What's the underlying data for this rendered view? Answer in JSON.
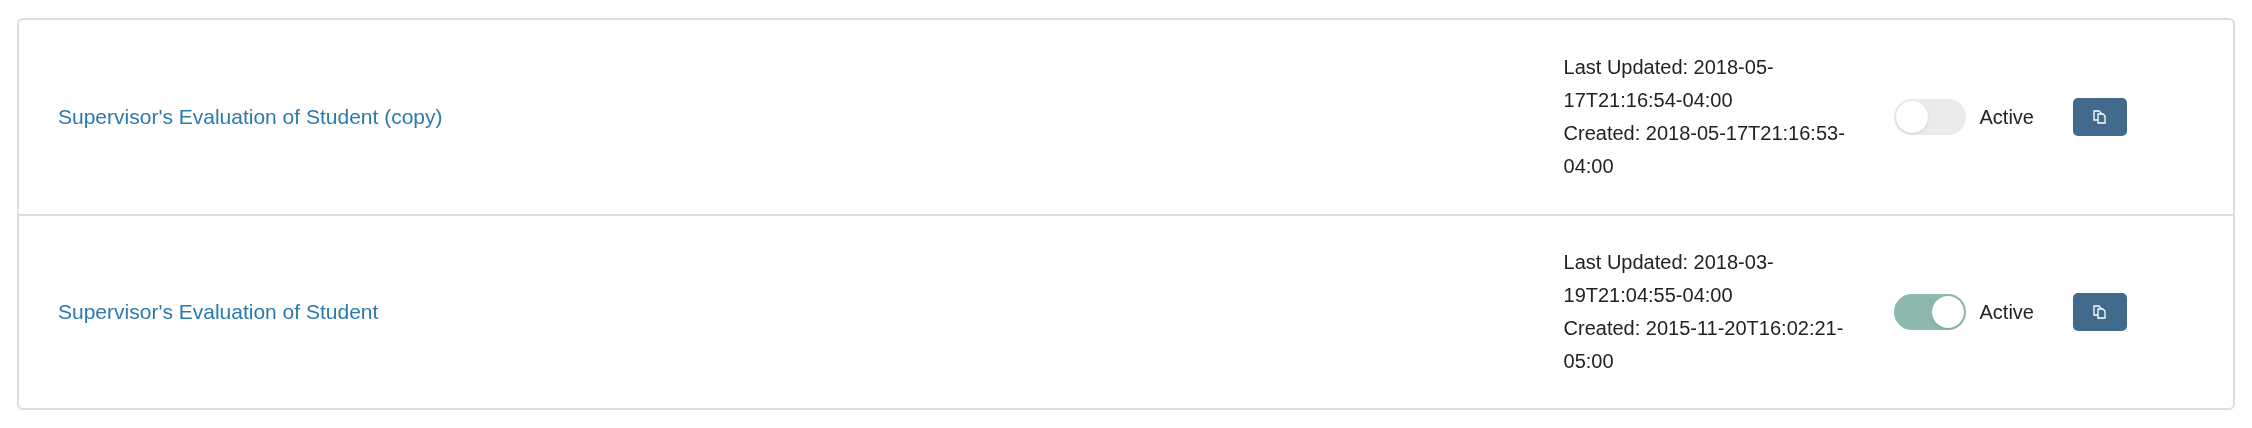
{
  "forms": [
    {
      "title": "Supervisor's Evaluation of Student (copy)",
      "last_updated": "Last Updated: 2018-05-17T21:16:54-04:00",
      "created": "Created: 2018-05-17T21:16:53-04:00",
      "active": false,
      "toggle_label": "Active"
    },
    {
      "title": "Supervisor's Evaluation of Student",
      "last_updated": "Last Updated: 2018-03-19T21:04:55-04:00",
      "created": "Created: 2015-11-20T16:02:21-05:00",
      "active": true,
      "toggle_label": "Active"
    }
  ]
}
